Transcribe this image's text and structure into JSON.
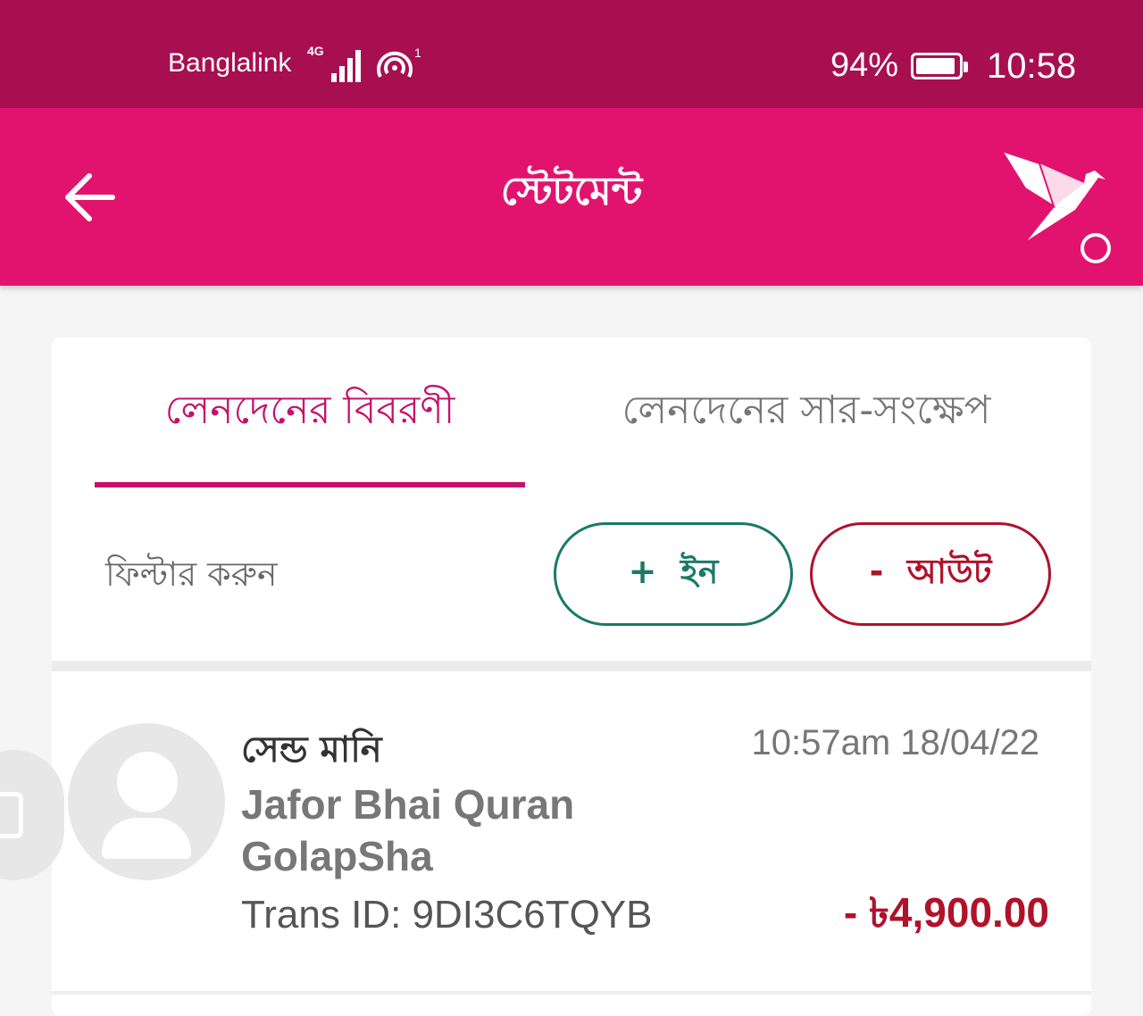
{
  "status_bar": {
    "carrier": "Banglalink",
    "network_tag": "4G",
    "battery_percent": "94%",
    "battery_level": 0.94,
    "time": "10:58",
    "hotspot_count": "1"
  },
  "app_bar": {
    "title": "স্টেটমেন্ট",
    "back_icon": "arrow-left-icon",
    "logo_icon": "bird-logo-icon"
  },
  "tabs": [
    {
      "label": "লেনদেনের বিবরণী",
      "active": true
    },
    {
      "label": "লেনদেনের সার-সংক্ষেপ",
      "active": false
    }
  ],
  "filter": {
    "label": "ফিল্টার করুন",
    "in_label": "+  ইন",
    "out_label": "-  আউট"
  },
  "transactions": [
    {
      "type": "সেন্ড মানি",
      "datetime": "10:57am 18/04/22",
      "name": "Jafor Bhai Quran GolapSha",
      "trans_id": "Trans ID: 9DI3C6TQYB",
      "amount": "- ৳4,900.00"
    }
  ],
  "colors": {
    "status_bar": "#a80f51",
    "brand": "#e2136e",
    "active_tab": "#c5116b",
    "in": "#1a7a64",
    "out": "#b0122a"
  }
}
